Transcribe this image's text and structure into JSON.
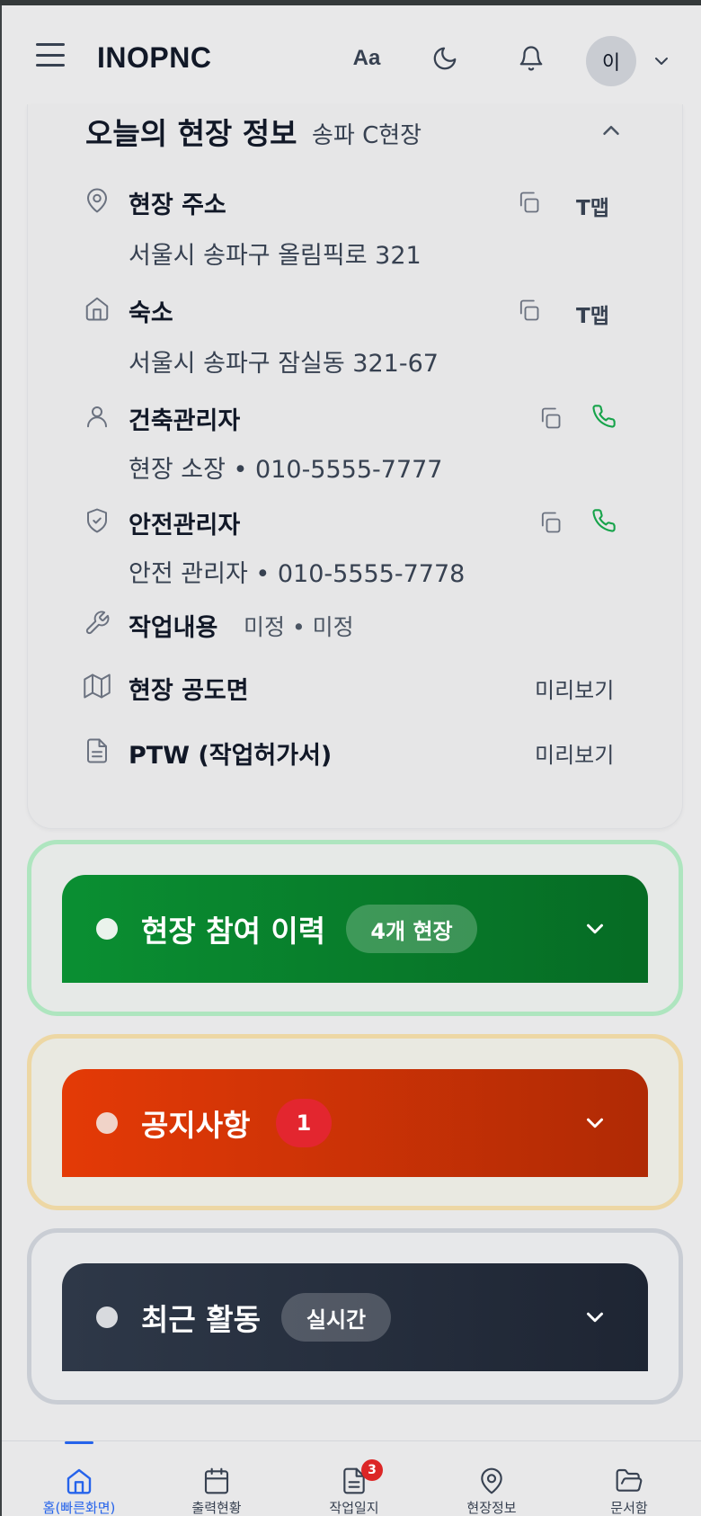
{
  "header": {
    "brand": "INOPNC",
    "font_size_label": "Aa",
    "avatar_initial": "이"
  },
  "site_info": {
    "title": "오늘의 현장 정보",
    "site_name": "송파 C현장",
    "address": {
      "label": "현장 주소",
      "value": "서울시 송파구 올림픽로 321",
      "tmap_label": "T맵"
    },
    "lodging": {
      "label": "숙소",
      "value": "서울시 송파구 잠실동 321-67",
      "tmap_label": "T맵"
    },
    "construction_manager": {
      "label": "건축관리자",
      "value": "현장 소장 • 010-5555-7777"
    },
    "safety_manager": {
      "label": "안전관리자",
      "value": "안전 관리자 • 010-5555-7778"
    },
    "work_content": {
      "label": "작업내용",
      "value": "미정 • 미정"
    },
    "site_drawing": {
      "label": "현장 공도면",
      "action": "미리보기"
    },
    "ptw": {
      "label": "PTW (작업허가서)",
      "action": "미리보기"
    }
  },
  "panels": {
    "history": {
      "title": "현장 참여 이력",
      "badge": "4개 현장"
    },
    "notices": {
      "title": "공지사항",
      "badge": "1"
    },
    "activity": {
      "title": "최근 활동",
      "badge": "실시간"
    }
  },
  "bottom_nav": {
    "home": "홈(빠른화면)",
    "attendance": "출력현황",
    "worklog": "작업일지",
    "worklog_badge": "3",
    "siteinfo": "현장정보",
    "documents": "문서함"
  },
  "colors": {
    "history_gradient": [
      "#0a8f32",
      "#066b24"
    ],
    "notices_gradient": [
      "#e43a06",
      "#b02a05"
    ],
    "activity_gradient": [
      "#2e3848",
      "#1e2533"
    ],
    "phone_green": "#16a34a",
    "nav_active": "#2563eb"
  }
}
